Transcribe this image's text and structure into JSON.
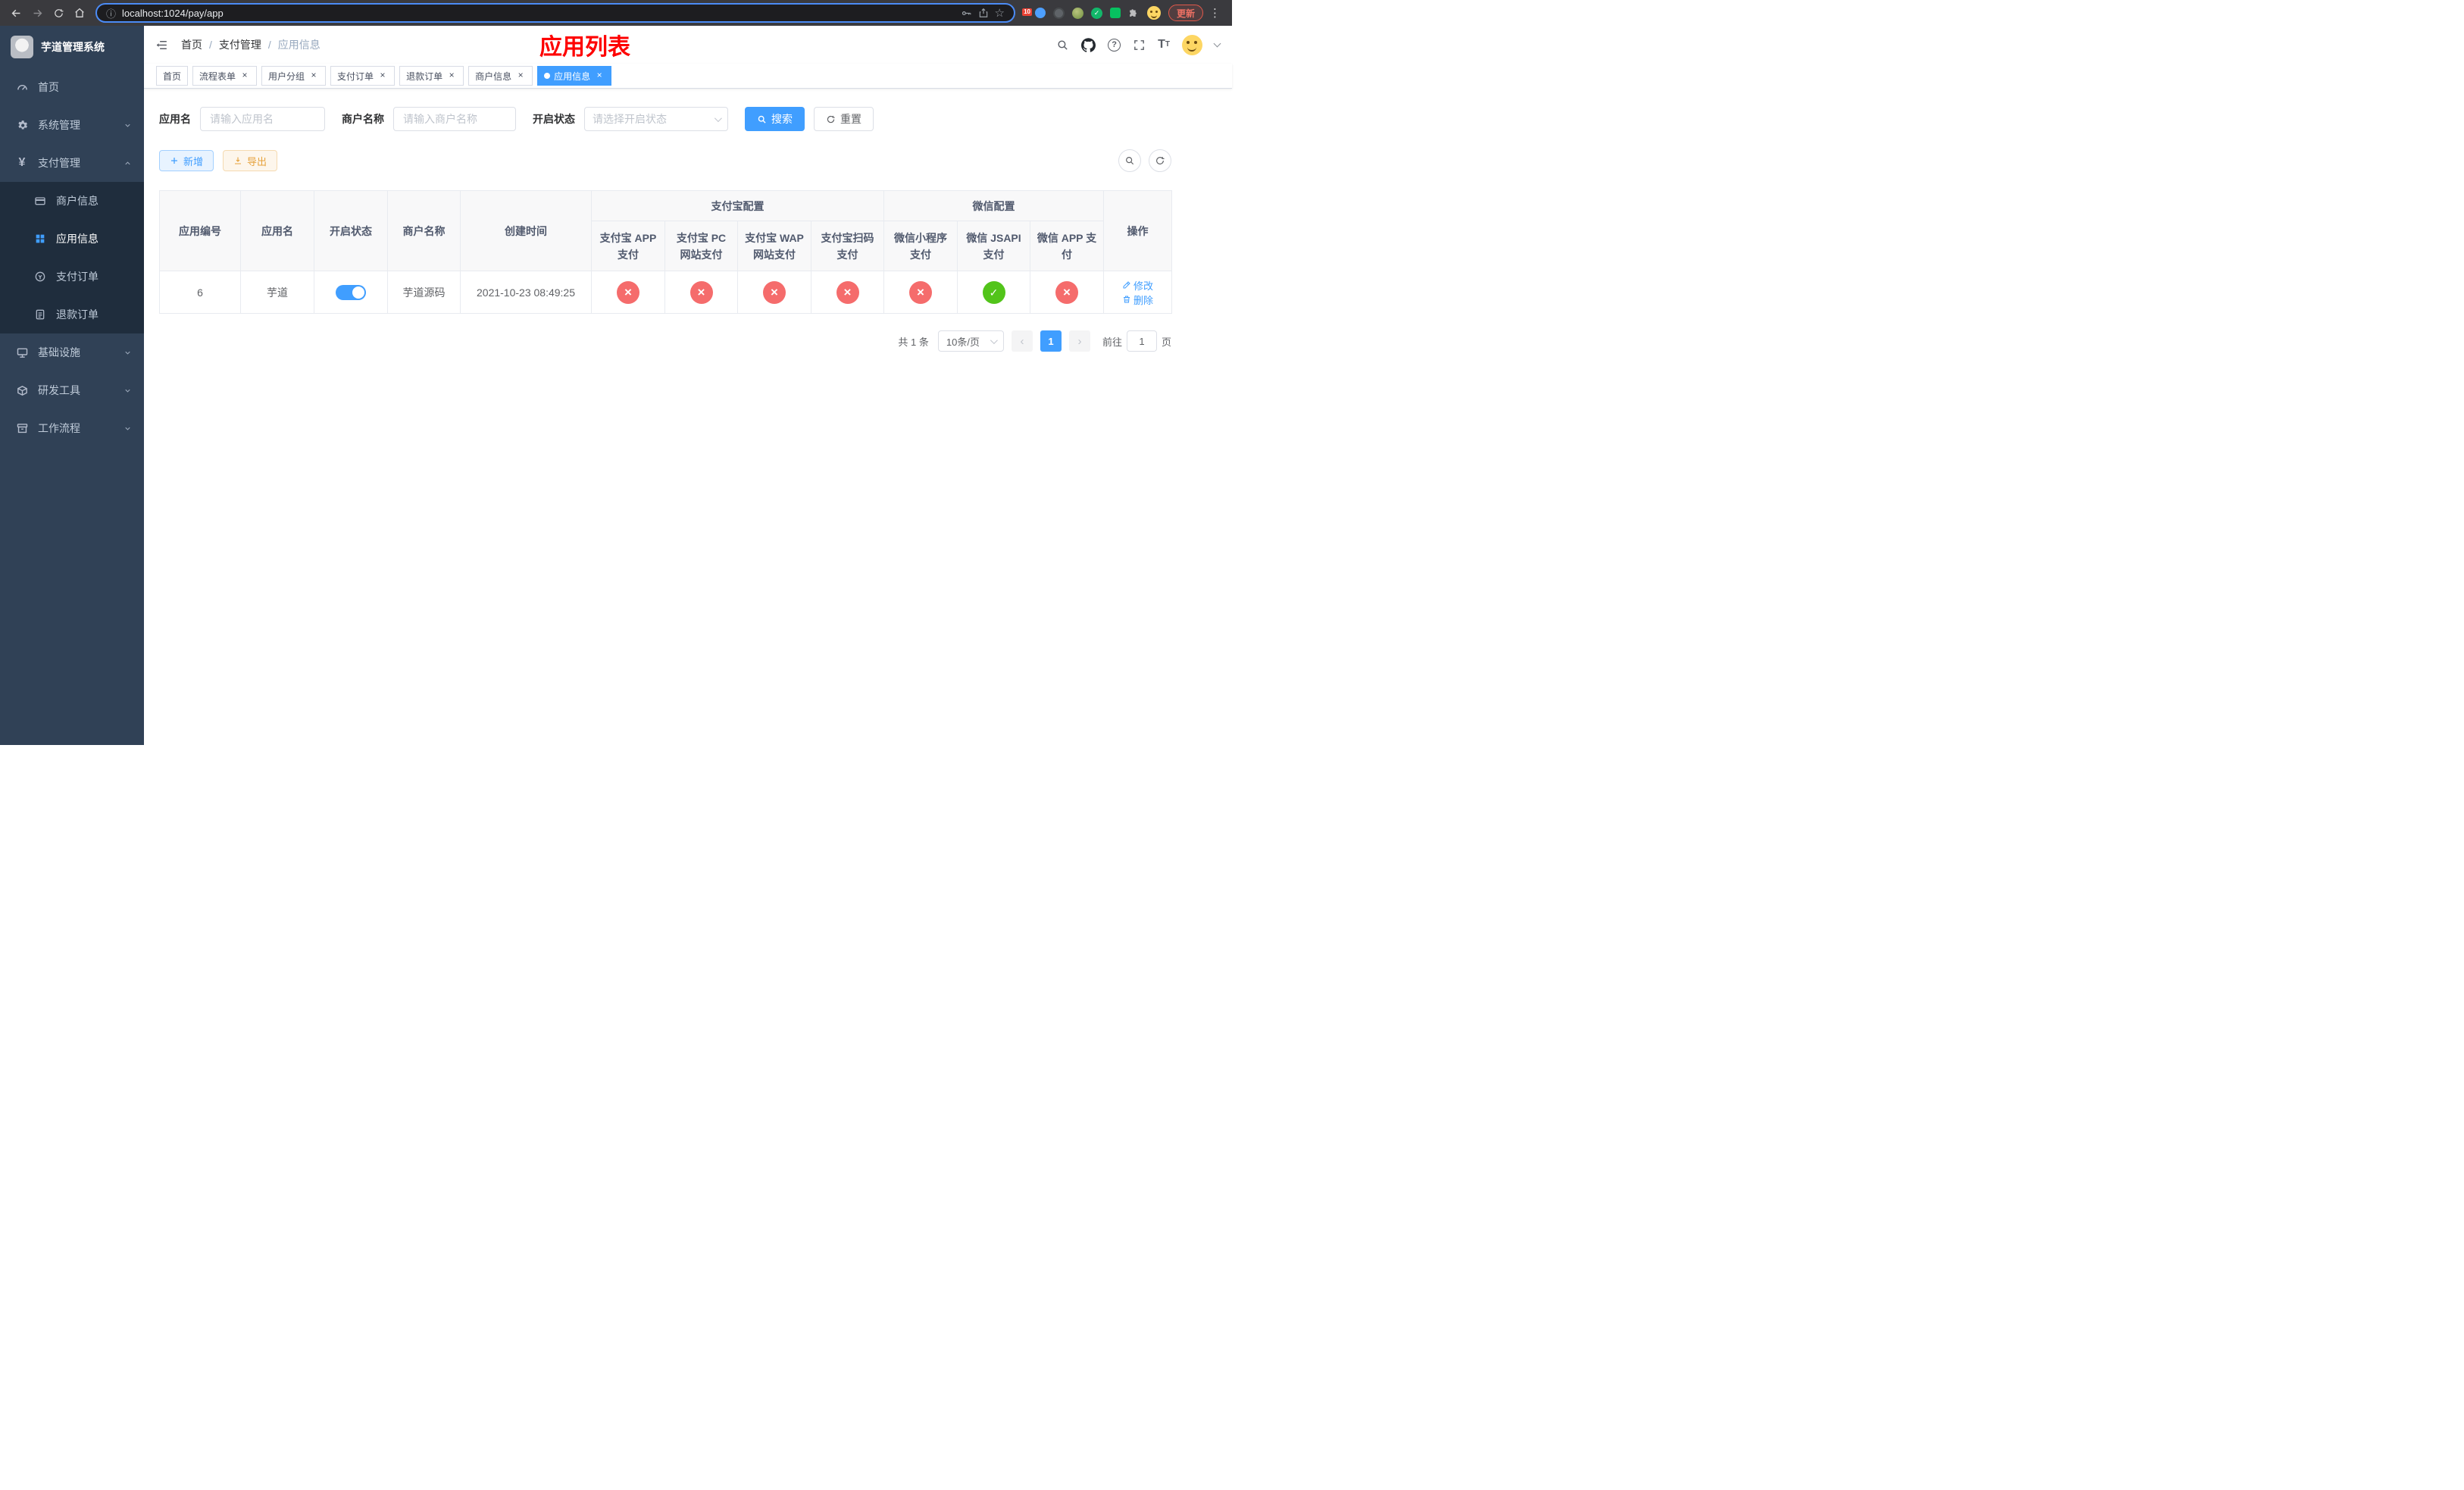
{
  "browser": {
    "url": "localhost:1024/pay/app",
    "update_button": "更新",
    "extension_badge": "10"
  },
  "sidebar": {
    "logo_title": "芋道管理系统",
    "items": [
      {
        "label": "首页"
      },
      {
        "label": "系统管理"
      },
      {
        "label": "支付管理"
      },
      {
        "label": "基础设施"
      },
      {
        "label": "研发工具"
      },
      {
        "label": "工作流程"
      }
    ],
    "pay_children": [
      {
        "label": "商户信息"
      },
      {
        "label": "应用信息"
      },
      {
        "label": "支付订单"
      },
      {
        "label": "退款订单"
      }
    ]
  },
  "header": {
    "breadcrumb": [
      "首页",
      "支付管理",
      "应用信息"
    ],
    "page_title": "应用列表"
  },
  "tabs": [
    {
      "label": "首页"
    },
    {
      "label": "流程表单"
    },
    {
      "label": "用户分组"
    },
    {
      "label": "支付订单"
    },
    {
      "label": "退款订单"
    },
    {
      "label": "商户信息"
    },
    {
      "label": "应用信息"
    }
  ],
  "filters": {
    "app_name_label": "应用名",
    "app_name_placeholder": "请输入应用名",
    "merchant_label": "商户名称",
    "merchant_placeholder": "请输入商户名称",
    "status_label": "开启状态",
    "status_placeholder": "请选择开启状态",
    "search_button": "搜索",
    "reset_button": "重置"
  },
  "toolbar": {
    "add_button": "新增",
    "export_button": "导出"
  },
  "table": {
    "group_alipay": "支付宝配置",
    "group_wechat": "微信配置",
    "columns": [
      "应用编号",
      "应用名",
      "开启状态",
      "商户名称",
      "创建时间",
      "支付宝 APP 支付",
      "支付宝 PC 网站支付",
      "支付宝 WAP 网站支付",
      "支付宝扫码支付",
      "微信小程序支付",
      "微信 JSAPI 支付",
      "微信 APP 支付",
      "操作"
    ],
    "rows": [
      {
        "id": "6",
        "name": "芋道",
        "enabled": true,
        "merchant": "芋道源码",
        "created": "2021-10-23 08:49:25",
        "configs": [
          false,
          false,
          false,
          false,
          false,
          true,
          false
        ],
        "edit_label": "修改",
        "delete_label": "删除"
      }
    ]
  },
  "pagination": {
    "total": "共 1 条",
    "page_size": "10条/页",
    "current_page": "1",
    "goto_label": "前往",
    "goto_value": "1",
    "goto_suffix": "页"
  }
}
